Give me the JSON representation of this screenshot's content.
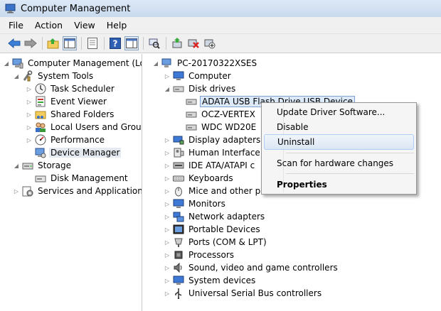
{
  "window": {
    "title": "Computer Management"
  },
  "menu": [
    "File",
    "Action",
    "View",
    "Help"
  ],
  "left_tree": {
    "root": "Computer Management (Local",
    "system_tools": "System Tools",
    "task_scheduler": "Task Scheduler",
    "event_viewer": "Event Viewer",
    "shared_folders": "Shared Folders",
    "local_users": "Local Users and Groups",
    "performance": "Performance",
    "device_manager": "Device Manager",
    "storage": "Storage",
    "disk_management": "Disk Management",
    "services": "Services and Applications"
  },
  "device_tree": {
    "computer_name": "PC-20170322XSES",
    "categories": {
      "computer": "Computer",
      "disk_drives": "Disk drives",
      "display_adapters": "Display adapters",
      "hid": "Human Interface",
      "ide": "IDE ATA/ATAPI c",
      "keyboards": "Keyboards",
      "mice": "Mice and other p",
      "monitors": "Monitors",
      "network": "Network adapters",
      "portable": "Portable Devices",
      "ports": "Ports (COM & LPT)",
      "processors": "Processors",
      "sound": "Sound, video and game controllers",
      "system_devices": "System devices",
      "usb": "Universal Serial Bus controllers"
    },
    "disks": [
      "ADATA USB Flash Drive USB Device",
      "OCZ-VERTEX",
      "WDC WD20E"
    ]
  },
  "context_menu": {
    "update": "Update Driver Software...",
    "disable": "Disable",
    "uninstall": "Uninstall",
    "scan": "Scan for hardware changes",
    "properties": "Properties"
  }
}
